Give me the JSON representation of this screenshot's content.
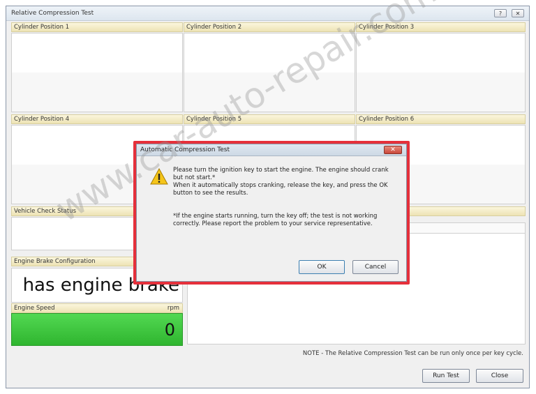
{
  "window": {
    "title": "Relative Compression Test",
    "help_label": "?",
    "close_label": "✕"
  },
  "cylinders": [
    {
      "label": "Cylinder Position 1"
    },
    {
      "label": "Cylinder Position 2"
    },
    {
      "label": "Cylinder Position 3"
    },
    {
      "label": "Cylinder Position 4"
    },
    {
      "label": "Cylinder Position 5"
    },
    {
      "label": "Cylinder Position 6"
    }
  ],
  "vehicle_check": {
    "label": "Vehicle Check Status"
  },
  "engine_brake": {
    "label": "Engine Brake Configuration",
    "value": "has engine brake"
  },
  "engine_speed": {
    "label": "Engine Speed",
    "unit": "rpm",
    "value": "0"
  },
  "note": "NOTE - The Relative Compression Test can be run only once per key cycle.",
  "buttons": {
    "run_test": "Run Test",
    "close": "Close"
  },
  "dialog": {
    "title": "Automatic Compression Test",
    "close_label": "✕",
    "icon": "warning-icon",
    "line1": "Please turn the ignition key to start the engine. The engine should crank",
    "line2": "but not start.*",
    "line3": "When it automatically stops cranking, release the key, and press the OK",
    "line4": "button to see the results.",
    "line5": "*If the engine starts running, turn the key off; the test is not working",
    "line6": "correctly. Please report the problem to your service representative.",
    "ok_label": "OK",
    "cancel_label": "Cancel",
    "highlight_color": "#e5303b"
  },
  "watermark": "www.car-auto-repair.com"
}
